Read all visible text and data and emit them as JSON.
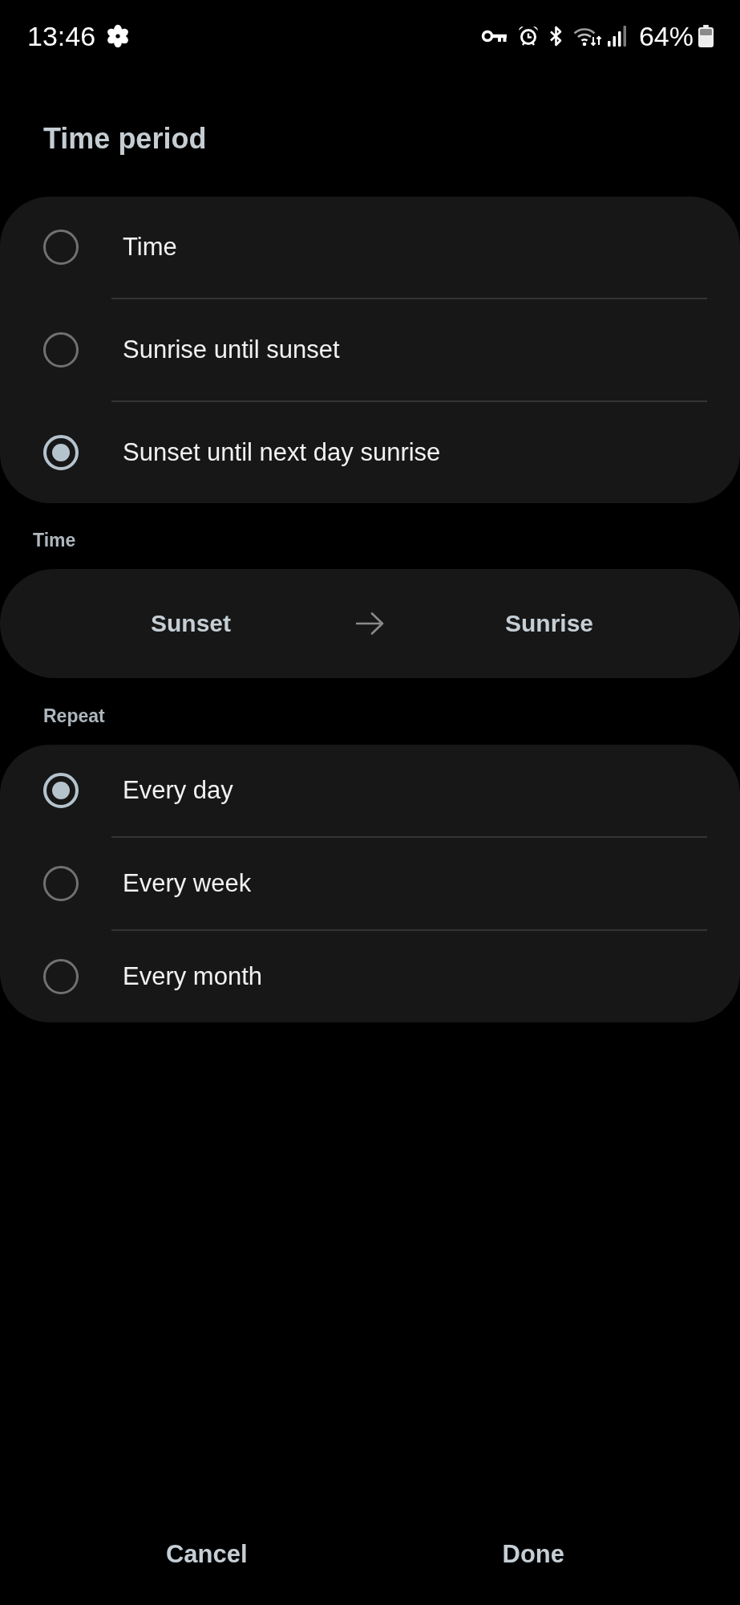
{
  "status_bar": {
    "time": "13:46",
    "battery": "64%"
  },
  "title": "Time period",
  "time_period": {
    "options": [
      {
        "label": "Time",
        "selected": false
      },
      {
        "label": "Sunrise until sunset",
        "selected": false
      },
      {
        "label": "Sunset until next day sunrise",
        "selected": true
      }
    ]
  },
  "time": {
    "label": "Time",
    "start": "Sunset",
    "end": "Sunrise"
  },
  "repeat": {
    "label": "Repeat",
    "options": [
      {
        "label": "Every day",
        "selected": true
      },
      {
        "label": "Every week",
        "selected": false
      },
      {
        "label": "Every month",
        "selected": false
      }
    ]
  },
  "buttons": [
    "Cancel",
    "Done"
  ]
}
